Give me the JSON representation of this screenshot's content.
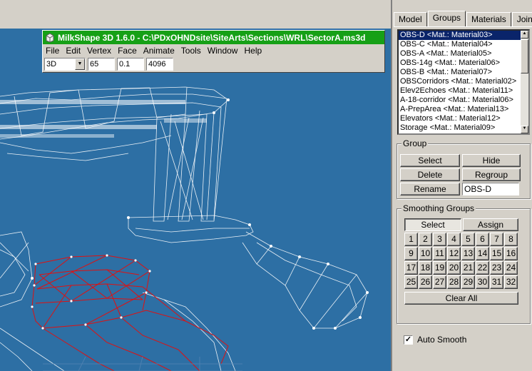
{
  "window": {
    "title": "MilkShape 3D 1.6.0 - C:\\PDxOHNDsite\\SiteArts\\Sections\\WRL\\SectorA.ms3d"
  },
  "menu": [
    "File",
    "Edit",
    "Vertex",
    "Face",
    "Animate",
    "Tools",
    "Window",
    "Help"
  ],
  "toolbar": {
    "view_mode": "3D",
    "field1": "65",
    "field2": "0.1",
    "field3": "4096"
  },
  "tabs": [
    "Model",
    "Groups",
    "Materials",
    "Joints"
  ],
  "active_tab": "Groups",
  "groups": [
    "OBS-D <Mat.: Material03>",
    "OBS-C <Mat.: Material04>",
    "OBS-A <Mat.: Material05>",
    "OBS-14g <Mat.: Material06>",
    "OBS-B <Mat.: Material07>",
    "OBSCorridors <Mat.: Material02>",
    "Elev2Echoes <Mat.: Material11>",
    "A-18-corridor <Mat.: Material06>",
    "A-PrepArea <Mat.: Material13>",
    "Elevators <Mat.: Material12>",
    "Storage <Mat.: Material09>"
  ],
  "group_box": {
    "title": "Group",
    "select": "Select",
    "hide": "Hide",
    "delete": "Delete",
    "regroup": "Regroup",
    "rename": "Rename",
    "name_value": "OBS-D"
  },
  "smoothing": {
    "title": "Smoothing Groups",
    "select": "Select",
    "assign": "Assign",
    "numbers": [
      "1",
      "2",
      "3",
      "4",
      "5",
      "6",
      "7",
      "8",
      "9",
      "10",
      "11",
      "12",
      "13",
      "14",
      "15",
      "16",
      "17",
      "18",
      "19",
      "20",
      "21",
      "22",
      "23",
      "24",
      "25",
      "26",
      "27",
      "28",
      "29",
      "30",
      "31",
      "32"
    ],
    "clear_all": "Clear All",
    "auto_smooth": "Auto Smooth"
  },
  "colors": {
    "viewport_bg": "#2d6fa4",
    "title_bar": "#16a016",
    "wire_white": "#ffffff",
    "wire_red": "#e01010",
    "selection": "#0a246a"
  }
}
